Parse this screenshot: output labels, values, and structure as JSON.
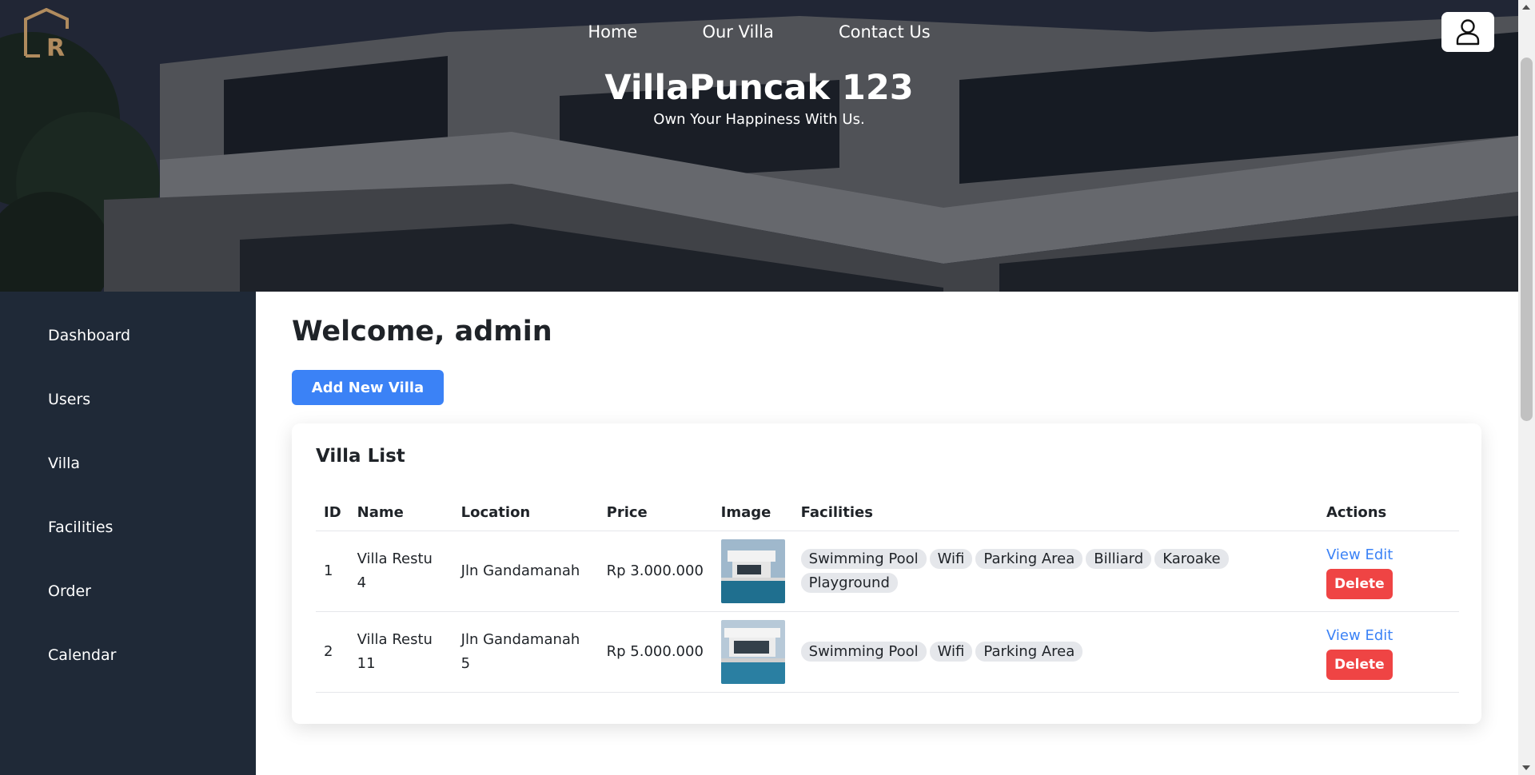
{
  "header": {
    "nav": [
      "Home",
      "Our Villa",
      "Contact Us"
    ],
    "title": "VillaPuncak 123",
    "tagline": "Own Your Happiness With Us.",
    "logo_letter": "R"
  },
  "sidebar": {
    "items": [
      "Dashboard",
      "Users",
      "Villa",
      "Facilities",
      "Order",
      "Calendar"
    ]
  },
  "main": {
    "welcome": "Welcome, admin",
    "add_button": "Add New Villa",
    "card_title": "Villa List",
    "columns": [
      "ID",
      "Name",
      "Location",
      "Price",
      "Image",
      "Facilities",
      "Actions"
    ],
    "rows": [
      {
        "id": "1",
        "name": "Villa Restu 4",
        "location": "Jln Gandamanah",
        "price": "Rp 3.000.000",
        "facilities": [
          "Swimming Pool",
          "Wifi",
          "Parking Area",
          "Billiard",
          "Karoake",
          "Playground"
        ],
        "view_label": "View",
        "edit_label": "Edit",
        "delete_label": "Delete"
      },
      {
        "id": "2",
        "name": "Villa Restu 11",
        "location": "Jln Gandamanah 5",
        "price": "Rp 5.000.000",
        "facilities": [
          "Swimming Pool",
          "Wifi",
          "Parking Area"
        ],
        "view_label": "View",
        "edit_label": "Edit",
        "delete_label": "Delete"
      }
    ]
  },
  "colors": {
    "sidebar_bg": "#1f2937",
    "primary": "#3b82f6",
    "danger": "#ef4444",
    "tag_bg": "#e5e7eb"
  },
  "icons": {
    "profile": "user-icon",
    "logo": "logo-icon"
  }
}
